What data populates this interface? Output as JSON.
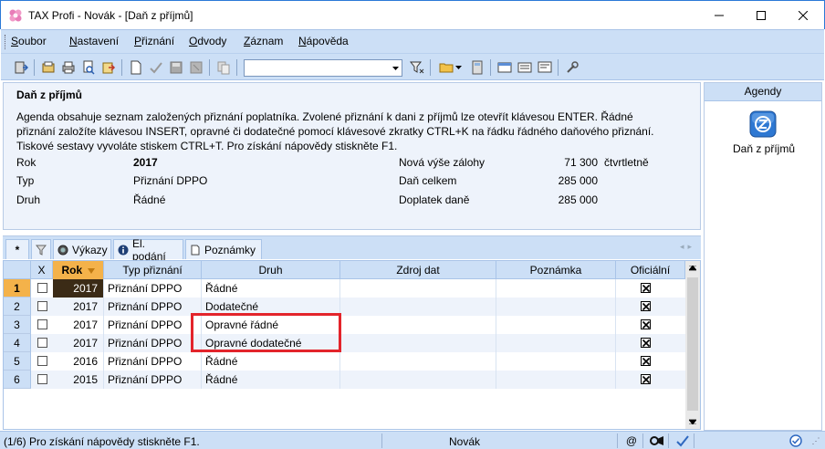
{
  "window": {
    "title": "TAX Profi - Novák - [Daň z příjmů]",
    "minimize_icon": "minimize-icon",
    "maximize_icon": "maximize-icon",
    "close_icon": "close-icon"
  },
  "menu": {
    "items": [
      {
        "u": "S",
        "rest": "oubor"
      },
      {
        "u": "N",
        "rest": "astavení"
      },
      {
        "u": "P",
        "rest": "řiznání"
      },
      {
        "u": "O",
        "rest": "dvody"
      },
      {
        "u": "Z",
        "rest": "áznam"
      },
      {
        "u": "N",
        "rest": "ápověda"
      }
    ]
  },
  "toolbar": {
    "search_value": ""
  },
  "info": {
    "header": "Daň z příjmů",
    "description": "Agenda obsahuje seznam založených přiznání poplatníka. Zvolené přiznání k dani z příjmů lze otevřít klávesou ENTER. Řádné přiznání založíte klávesou INSERT, opravné či dodatečné pomocí klávesové zkratky CTRL+K na řádku řádného daňového přiznání. Tiskové sestavy vyvoláte stiskem CTRL+T. Pro získání nápovědy stiskněte F1.",
    "rok_label": "Rok",
    "rok_value": "2017",
    "typ_label": "Typ",
    "typ_value": "Přiznání DPPO",
    "druh_label": "Druh",
    "druh_value": "Řádné",
    "zalohy_label": "Nová výše zálohy",
    "zalohy_value": "71 300",
    "zalohy_period": "čtvrtletně",
    "dan_label": "Daň celkem",
    "dan_value": "285 000",
    "doplatek_label": "Doplatek daně",
    "doplatek_value": "285 000"
  },
  "agendy": {
    "header": "Agendy",
    "item_label": "Daň z příjmů"
  },
  "tabs": {
    "star": "*",
    "vykazy": "Výkazy",
    "el_podani": "El. podání",
    "poznamky": "Poznámky"
  },
  "grid": {
    "columns": {
      "x": "X",
      "rok": "Rok",
      "typ": "Typ přiznání",
      "druh": "Druh",
      "zdroj": "Zdroj dat",
      "poznamka": "Poznámka",
      "oficialni": "Oficiální"
    },
    "rows": [
      {
        "n": "1",
        "rok": "2017",
        "typ": "Přiznání DPPO",
        "druh": "Řádné"
      },
      {
        "n": "2",
        "rok": "2017",
        "typ": "Přiznání DPPO",
        "druh": "Dodatečné"
      },
      {
        "n": "3",
        "rok": "2017",
        "typ": "Přiznání DPPO",
        "druh": "Opravné řádné"
      },
      {
        "n": "4",
        "rok": "2017",
        "typ": "Přiznání DPPO",
        "druh": "Opravné dodatečné"
      },
      {
        "n": "5",
        "rok": "2016",
        "typ": "Přiznání DPPO",
        "druh": "Řádné"
      },
      {
        "n": "6",
        "rok": "2015",
        "typ": "Přiznání DPPO",
        "druh": "Řádné"
      }
    ]
  },
  "status": {
    "message": "(1/6)  Pro získání nápovědy stiskněte F1.",
    "user": "Novák",
    "at": "@"
  }
}
